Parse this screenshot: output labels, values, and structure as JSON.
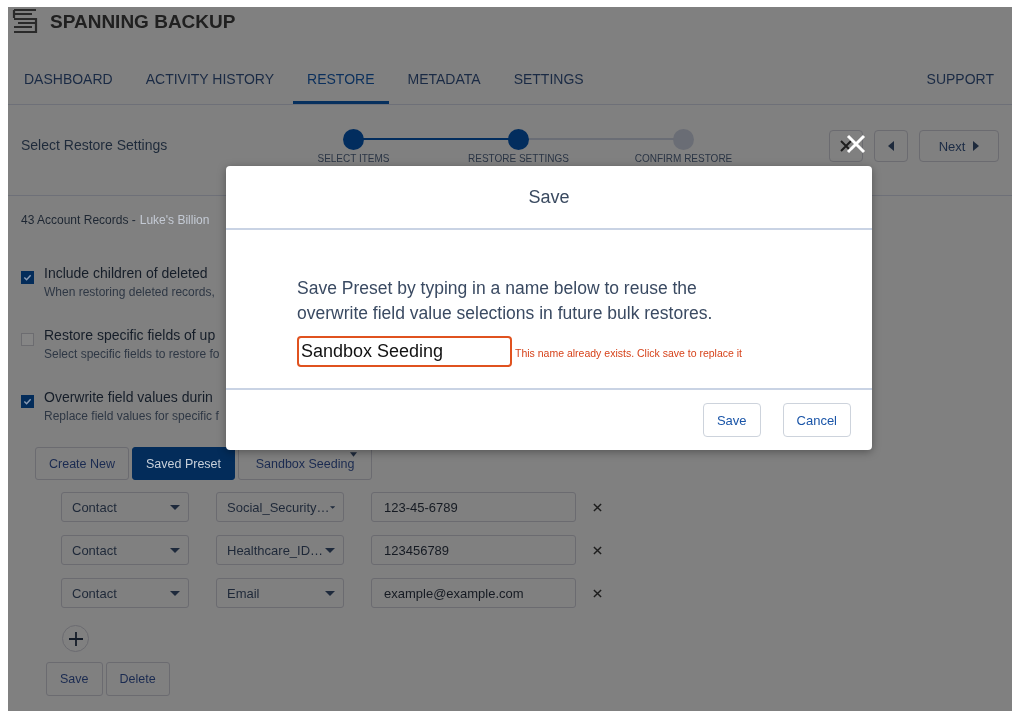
{
  "app": {
    "title": "SPANNING BACKUP"
  },
  "nav": {
    "tabs": [
      {
        "label": "DASHBOARD",
        "selected": false
      },
      {
        "label": "ACTIVITY HISTORY",
        "selected": false
      },
      {
        "label": "RESTORE",
        "selected": true
      },
      {
        "label": "METADATA",
        "selected": false
      },
      {
        "label": "SETTINGS",
        "selected": false
      }
    ],
    "support": "SUPPORT"
  },
  "wizard": {
    "title": "Select Restore Settings",
    "steps": [
      {
        "label": "SELECT ITEMS",
        "done": true
      },
      {
        "label": "RESTORE SETTINGS",
        "done": true
      },
      {
        "label": "CONFIRM RESTORE",
        "done": false
      }
    ],
    "next": "Next"
  },
  "records": {
    "count": "43 Account Records -",
    "name": "Luke's Billion"
  },
  "options": [
    {
      "label": "Include children of deleted",
      "description": "When restoring deleted records,",
      "checked": true
    },
    {
      "label": "Restore specific fields of up",
      "description": "Select specific fields to restore fo",
      "checked": false
    },
    {
      "label": "Overwrite field values durin",
      "description": "Replace field values for specific f",
      "checked": true
    }
  ],
  "preset_tabs": [
    {
      "label": "Create New",
      "selected": false
    },
    {
      "label": "Saved Preset",
      "selected": true
    }
  ],
  "preset_select": "Sandbox Seeding",
  "field_rows": [
    {
      "object": "Contact",
      "field": "Social_Security…",
      "value": "123-45-6789"
    },
    {
      "object": "Contact",
      "field": "Healthcare_ID…",
      "value": "123456789"
    },
    {
      "object": "Contact",
      "field": "Email",
      "value": "example@example.com"
    }
  ],
  "actions": [
    "Save",
    "Delete"
  ],
  "dialog": {
    "title": "Save",
    "message": "Save Preset by typing in a name below to reuse the overwrite field value selections in future bulk restores.",
    "name_value": "Sandbox Seeding",
    "error": "This name already exists. Click save to replace it",
    "buttons": [
      "Save",
      "Cancel"
    ]
  }
}
